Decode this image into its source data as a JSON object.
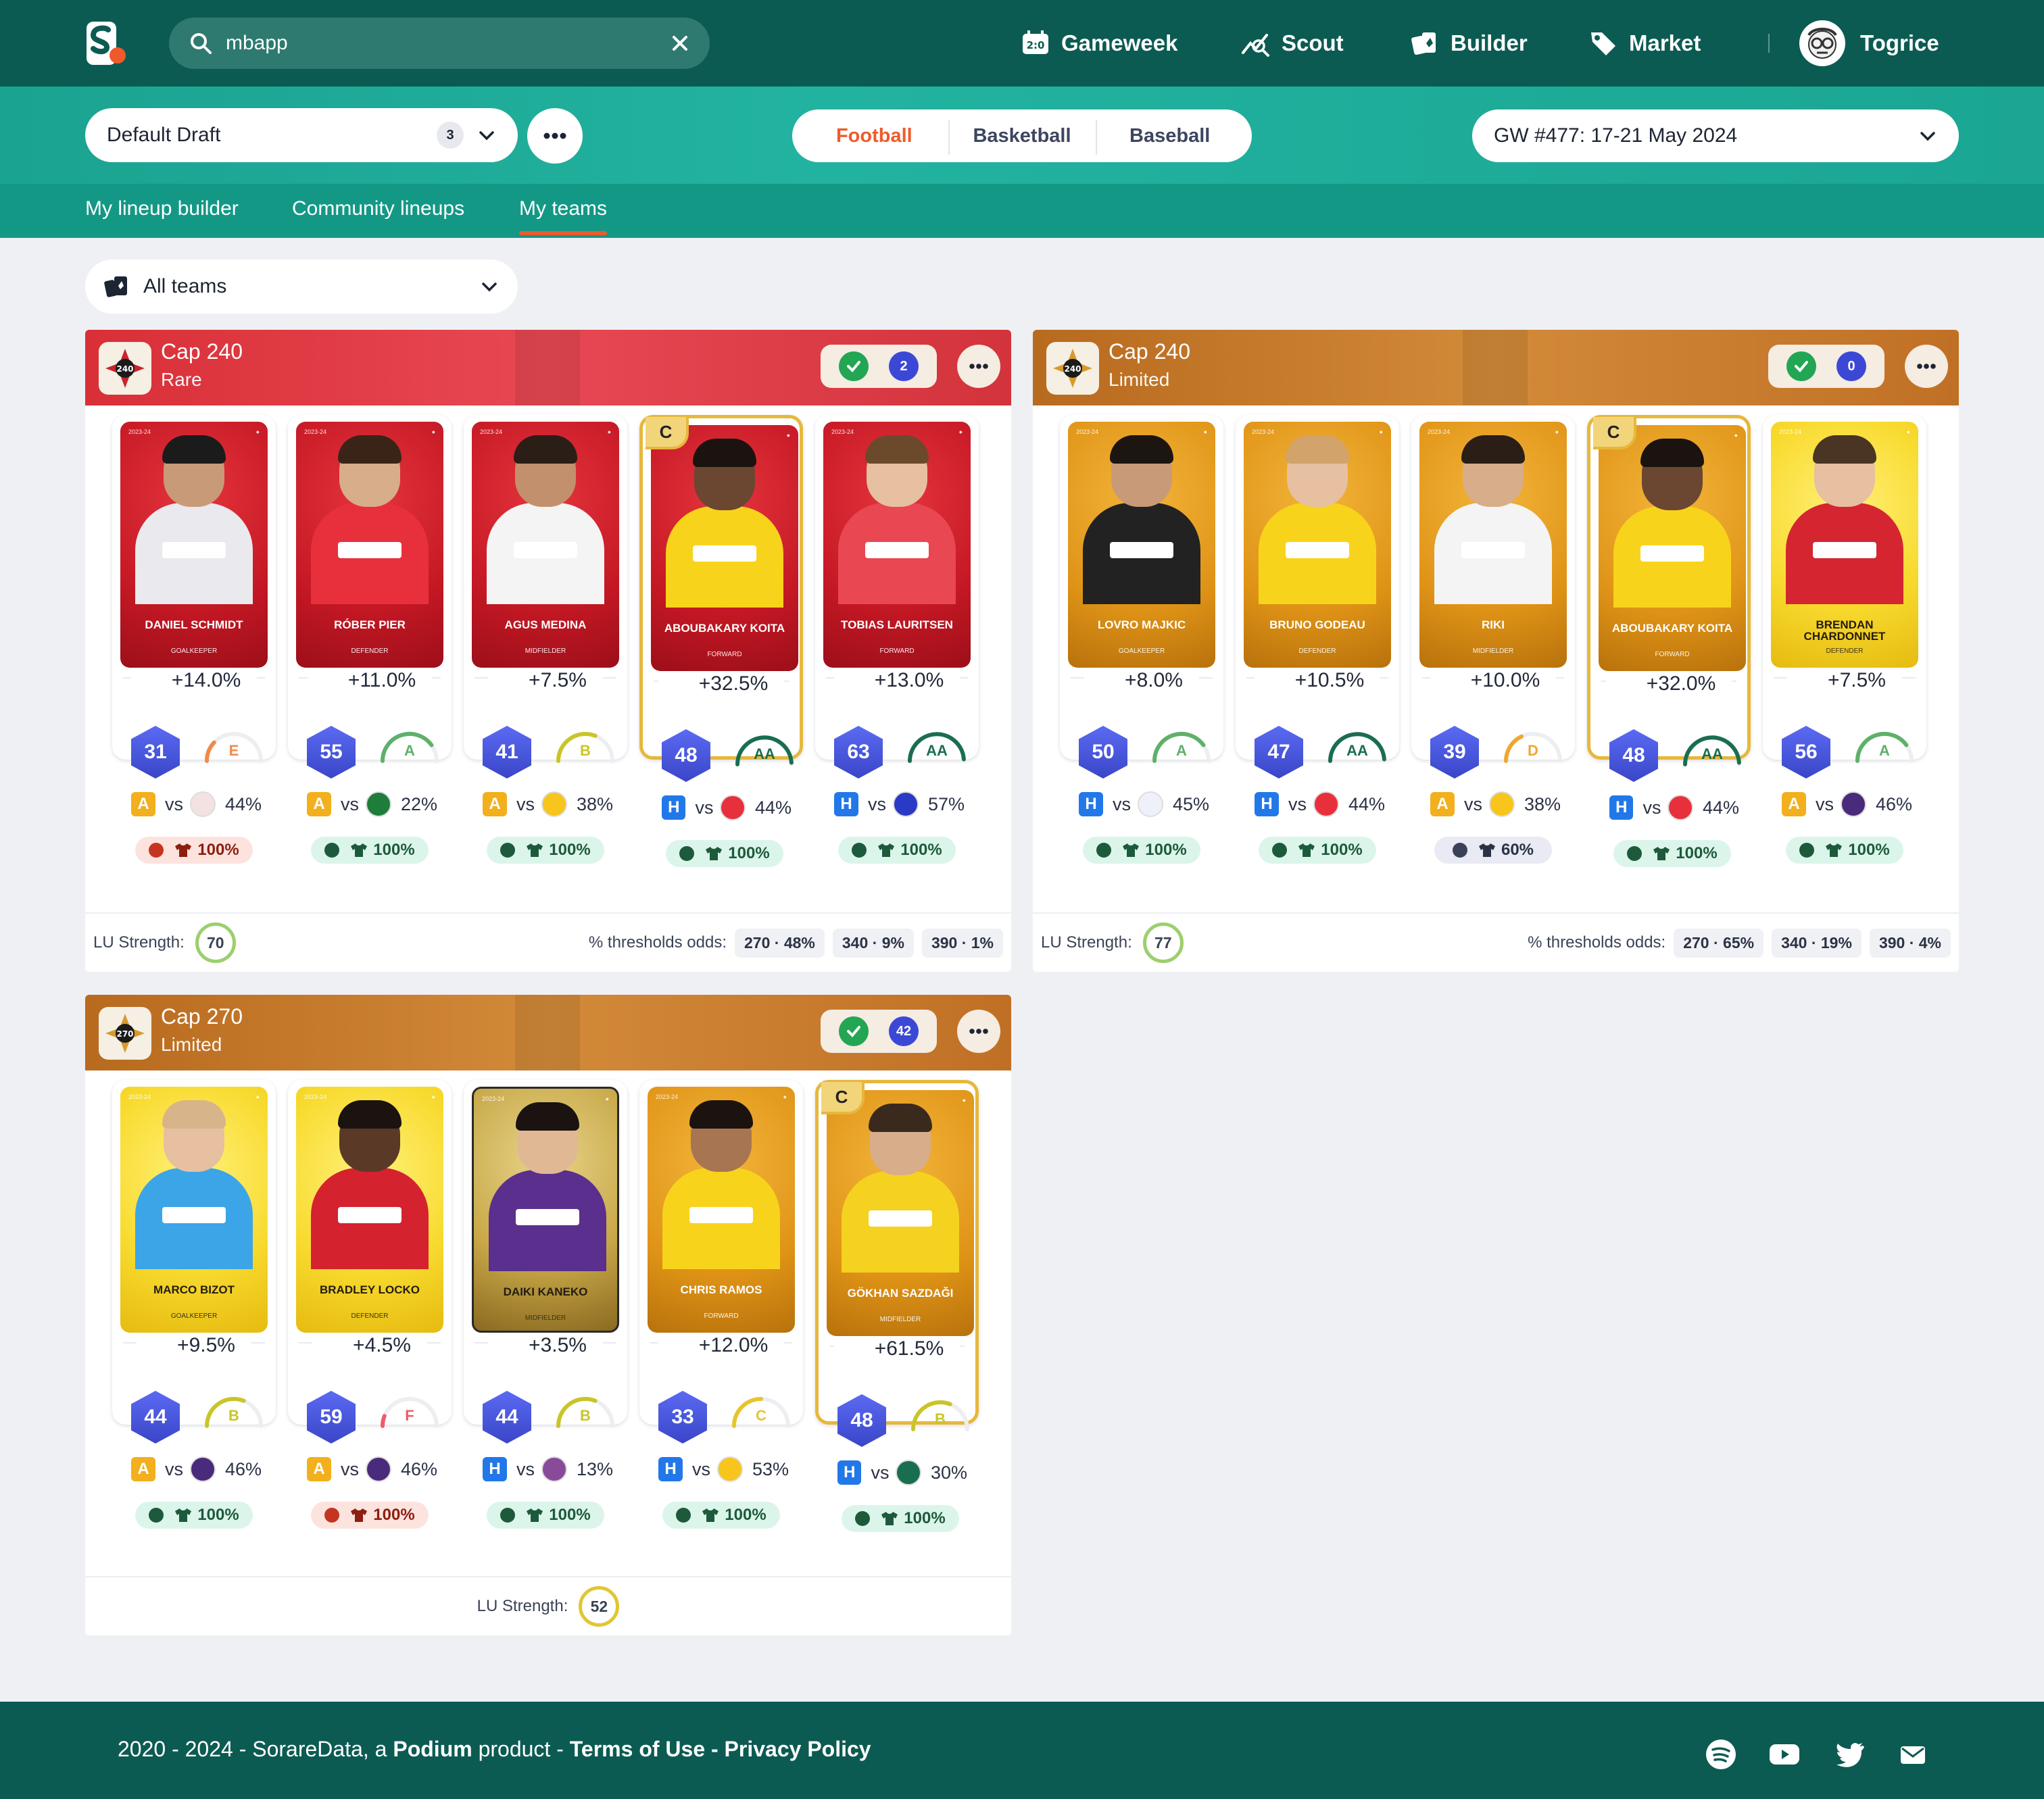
{
  "search": {
    "value": "mbapp"
  },
  "nav": {
    "gameweek": "Gameweek",
    "scout": "Scout",
    "builder": "Builder",
    "market": "Market",
    "user": "Togrice"
  },
  "draft": {
    "label": "Default Draft",
    "count": "3"
  },
  "sports": {
    "football": "Football",
    "basketball": "Basketball",
    "baseball": "Baseball",
    "active": "Football"
  },
  "gameweek_select": "GW #477: 17-21 May 2024",
  "tabs": {
    "builder": "My lineup builder",
    "community": "Community lineups",
    "myteams": "My teams"
  },
  "team_filter": "All teams",
  "panels": [
    {
      "title": "Cap 240",
      "subtitle": "Rare",
      "badge": "240",
      "count": "2",
      "lu_label": "LU Strength:",
      "lu_strength": "70",
      "odds_label": "% thresholds odds:",
      "odds": [
        "270 · 48%",
        "340 · 9%",
        "390 · 1%"
      ],
      "players": [
        {
          "name": "DANIEL SCHMIDT",
          "position": "GOALKEEPER",
          "score": "+14.0%",
          "rating": "31",
          "grade": "E",
          "venue": "A",
          "vs": "vs",
          "prob": "44%",
          "status": "100%",
          "captain": false
        },
        {
          "name": "RÓBER PIER",
          "position": "DEFENDER",
          "score": "+11.0%",
          "rating": "55",
          "grade": "A",
          "venue": "A",
          "vs": "vs",
          "prob": "22%",
          "status": "100%",
          "captain": false
        },
        {
          "name": "AGUS MEDINA",
          "position": "MIDFIELDER",
          "score": "+7.5%",
          "rating": "41",
          "grade": "B",
          "venue": "A",
          "vs": "vs",
          "prob": "38%",
          "status": "100%",
          "captain": false
        },
        {
          "name": "ABOUBAKARY KOITA",
          "position": "FORWARD",
          "score": "+32.5%",
          "rating": "48",
          "grade": "AA",
          "venue": "H",
          "vs": "vs",
          "prob": "44%",
          "status": "100%",
          "captain": true
        },
        {
          "name": "TOBIAS LAURITSEN",
          "position": "FORWARD",
          "score": "+13.0%",
          "rating": "63",
          "grade": "AA",
          "venue": "H",
          "vs": "vs",
          "prob": "57%",
          "status": "100%",
          "captain": false
        }
      ]
    },
    {
      "title": "Cap 240",
      "subtitle": "Limited",
      "badge": "240",
      "count": "0",
      "lu_label": "LU Strength:",
      "lu_strength": "77",
      "odds_label": "% thresholds odds:",
      "odds": [
        "270 · 65%",
        "340 · 19%",
        "390 · 4%"
      ],
      "players": [
        {
          "name": "LOVRO MAJKIC",
          "position": "GOALKEEPER",
          "score": "+8.0%",
          "rating": "50",
          "grade": "A",
          "venue": "H",
          "vs": "vs",
          "prob": "45%",
          "status": "100%",
          "captain": false
        },
        {
          "name": "BRUNO GODEAU",
          "position": "DEFENDER",
          "score": "+10.5%",
          "rating": "47",
          "grade": "AA",
          "venue": "H",
          "vs": "vs",
          "prob": "44%",
          "status": "100%",
          "captain": false
        },
        {
          "name": "RIKI",
          "position": "MIDFIELDER",
          "score": "+10.0%",
          "rating": "39",
          "grade": "D",
          "venue": "A",
          "vs": "vs",
          "prob": "38%",
          "status": "60%",
          "captain": false
        },
        {
          "name": "ABOUBAKARY KOITA",
          "position": "FORWARD",
          "score": "+32.0%",
          "rating": "48",
          "grade": "AA",
          "venue": "H",
          "vs": "vs",
          "prob": "44%",
          "status": "100%",
          "captain": true
        },
        {
          "name": "BRENDAN CHARDONNET",
          "position": "DEFENDER",
          "score": "+7.5%",
          "rating": "56",
          "grade": "A",
          "venue": "A",
          "vs": "vs",
          "prob": "46%",
          "status": "100%",
          "captain": false
        }
      ]
    },
    {
      "title": "Cap 270",
      "subtitle": "Limited",
      "badge": "270",
      "count": "42",
      "lu_label": "LU Strength:",
      "lu_strength": "52",
      "players": [
        {
          "name": "MARCO BIZOT",
          "position": "GOALKEEPER",
          "score": "+9.5%",
          "rating": "44",
          "grade": "B",
          "venue": "A",
          "vs": "vs",
          "prob": "46%",
          "status": "100%",
          "captain": false
        },
        {
          "name": "BRADLEY LOCKO",
          "position": "DEFENDER",
          "score": "+4.5%",
          "rating": "59",
          "grade": "F",
          "venue": "A",
          "vs": "vs",
          "prob": "46%",
          "status": "100%",
          "captain": false
        },
        {
          "name": "DAIKI KANEKO",
          "position": "MIDFIELDER",
          "score": "+3.5%",
          "rating": "44",
          "grade": "B",
          "venue": "H",
          "vs": "vs",
          "prob": "13%",
          "status": "100%",
          "captain": false
        },
        {
          "name": "CHRIS RAMOS",
          "position": "FORWARD",
          "score": "+12.0%",
          "rating": "33",
          "grade": "C",
          "venue": "H",
          "vs": "vs",
          "prob": "53%",
          "status": "100%",
          "captain": false
        },
        {
          "name": "GÖKHAN SAZDAĞI",
          "position": "MIDFIELDER",
          "score": "+61.5%",
          "rating": "48",
          "grade": "B",
          "venue": "H",
          "vs": "vs",
          "prob": "30%",
          "status": "100%",
          "captain": true
        }
      ]
    }
  ],
  "captain_label": "C",
  "footer": {
    "prefix": "2020 - 2024 - SorareData, a ",
    "brand": "Podium",
    "middle": " product - ",
    "terms": "Terms of Use",
    "dash": " - ",
    "privacy": "Privacy Policy"
  },
  "colors": {
    "brand": "#0c5b52",
    "accent": "#ee5b2c",
    "rare": "#d92f37",
    "limited": "#c07025"
  }
}
